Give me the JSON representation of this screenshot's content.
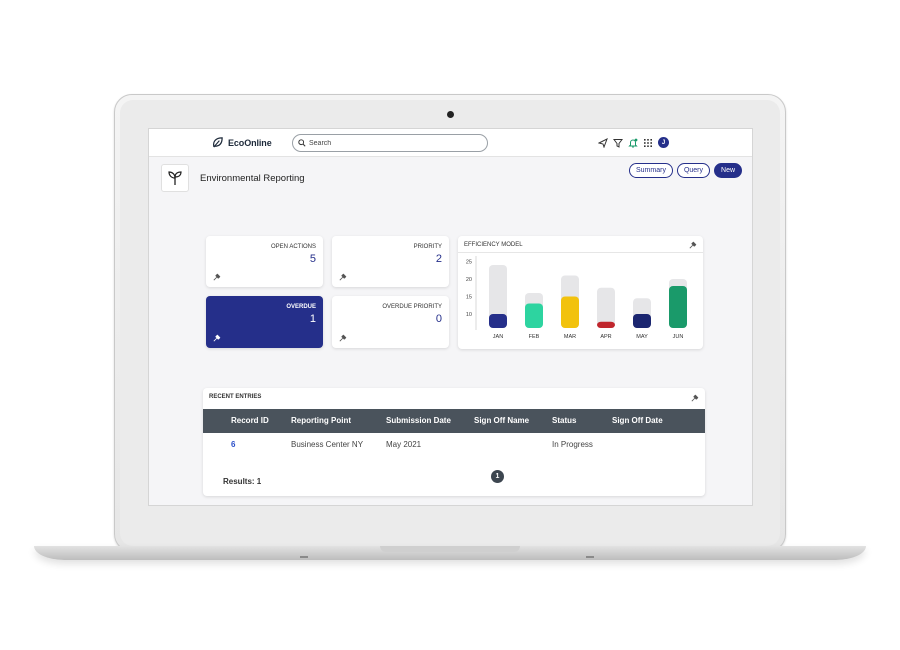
{
  "app": {
    "name": "EcoOnline"
  },
  "search": {
    "placeholder": "Search"
  },
  "user": {
    "initial": "J"
  },
  "page": {
    "title": "Environmental Reporting"
  },
  "actions": {
    "summary": "Summary",
    "query": "Query",
    "new": "New"
  },
  "stats": {
    "open_actions": {
      "label": "OPEN ACTIONS",
      "value": "5"
    },
    "priority": {
      "label": "PRIORITY",
      "value": "2"
    },
    "overdue": {
      "label": "OVERDUE",
      "value": "1"
    },
    "overdue_priority": {
      "label": "OVERDUE PRIORITY",
      "value": "0"
    }
  },
  "colors": {
    "primary": "#252f8a",
    "header": "#4a535c",
    "link": "#2a4fc9"
  },
  "chart_data": {
    "type": "bar",
    "title": "EFFICIENCY MODEL",
    "categories": [
      "JAN",
      "FEB",
      "MAR",
      "APR",
      "MAY",
      "JUN"
    ],
    "yticks": [
      10,
      15,
      20,
      25
    ],
    "ylim": [
      6,
      26
    ],
    "series": [
      {
        "values": [
          24,
          16,
          21,
          17.5,
          14.5,
          20
        ],
        "color": "#e6e6e8"
      },
      {
        "values": [
          10,
          13,
          15,
          7.8,
          10,
          18
        ]
      }
    ],
    "bar_colors": [
      "#252f8a",
      "#2dd4a0",
      "#f2c20d",
      "#c0262d",
      "#1b2670",
      "#1a9a6a"
    ],
    "grid": false,
    "xlabel": "",
    "ylabel": ""
  },
  "recent": {
    "title": "RECENT ENTRIES",
    "columns": [
      "Record ID",
      "Reporting Point",
      "Submission Date",
      "Sign Off Name",
      "Status",
      "Sign Off Date"
    ],
    "rows": [
      {
        "record_id": "6",
        "reporting_point": "Business Center NY",
        "submission_date": "May 2021",
        "sign_off_name": "",
        "status": "In Progress",
        "sign_off_date": ""
      }
    ],
    "page": "1",
    "results": "Results: 1"
  }
}
